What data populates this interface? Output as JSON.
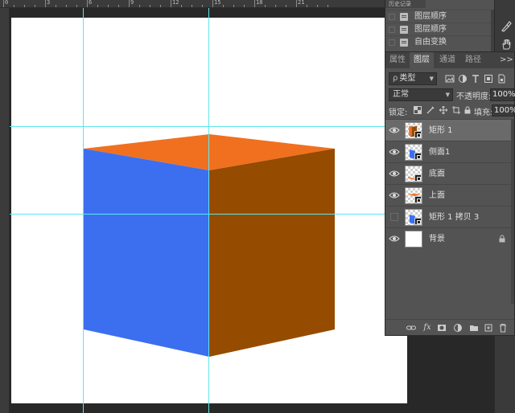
{
  "ruler": {
    "top_marks": [
      "0",
      "3",
      "6",
      "9",
      "12",
      "15",
      "18",
      "21"
    ]
  },
  "history": {
    "tab_label": "历史记录",
    "items": [
      {
        "label": "图层顺序"
      },
      {
        "label": "图层顺序"
      },
      {
        "label": "自由变换"
      }
    ]
  },
  "layers_panel": {
    "tabs": [
      {
        "label": "属性",
        "active": false
      },
      {
        "label": "图层",
        "active": true
      },
      {
        "label": "通道",
        "active": false
      },
      {
        "label": "路径",
        "active": false
      }
    ],
    "menu_glyph": ">>",
    "filter": {
      "symbol": "ρ",
      "label": "类型"
    },
    "blend_mode": "正常",
    "opacity_label": "不透明度:",
    "opacity_value": "100%",
    "lock_label": "锁定:",
    "fill_label": "填充:",
    "fill_value": "100%",
    "layers": [
      {
        "name": "矩形 1",
        "visible": true,
        "selected": true,
        "thumb": "orange-brown"
      },
      {
        "name": "侧面1",
        "visible": true,
        "selected": false,
        "thumb": "blue"
      },
      {
        "name": "底面",
        "visible": true,
        "selected": false,
        "thumb": "orange-line"
      },
      {
        "name": "上面",
        "visible": true,
        "selected": false,
        "thumb": "orange-line"
      },
      {
        "name": "矩形 1 拷贝 3",
        "visible": false,
        "selected": false,
        "thumb": "blue"
      },
      {
        "name": "背景",
        "visible": true,
        "selected": false,
        "thumb": "white",
        "locked": true
      }
    ],
    "bottom_icons": [
      "link-icon",
      "fx-icon",
      "mask-icon",
      "adjustment-icon",
      "folder-icon",
      "new-layer-icon",
      "trash-icon"
    ]
  },
  "canvas": {
    "cube_colors": {
      "top": "#f07020",
      "left": "#3b6ff0",
      "right": "#954b00"
    },
    "guide_color": "#5fe6ee"
  }
}
